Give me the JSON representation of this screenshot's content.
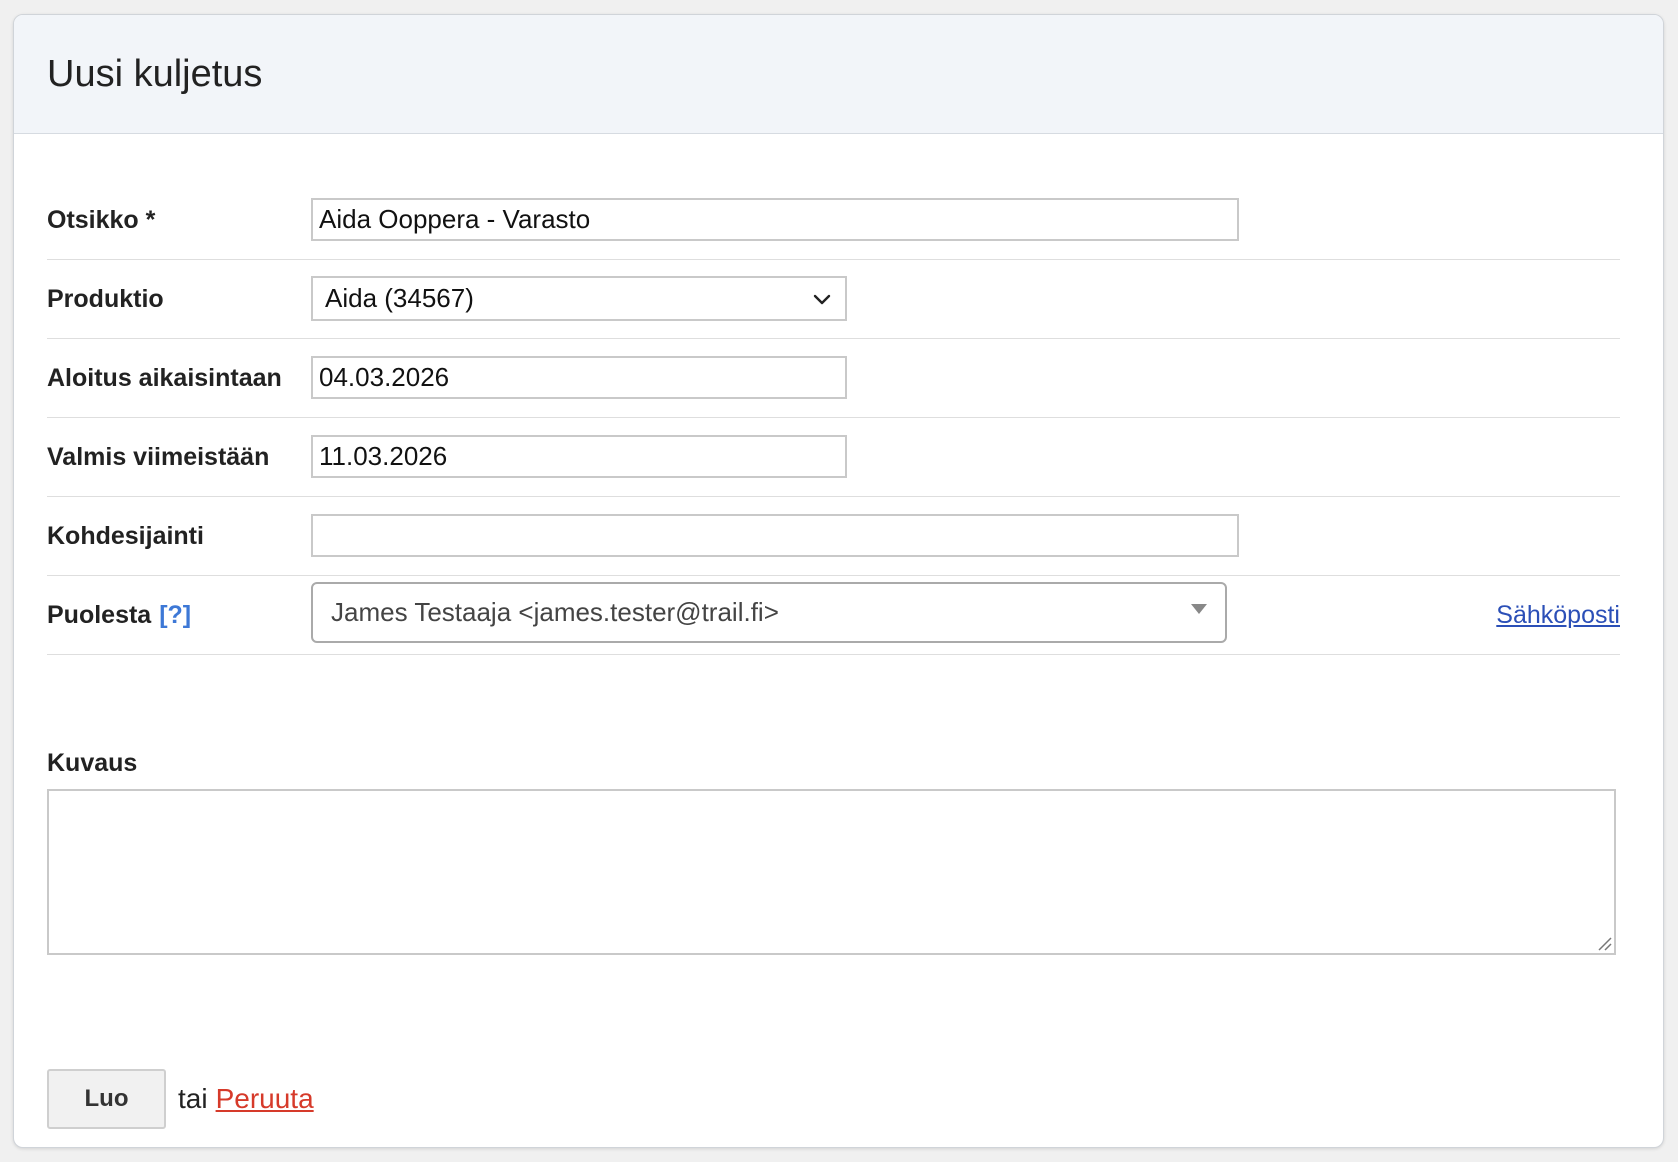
{
  "header": {
    "title": "Uusi kuljetus"
  },
  "form": {
    "title_field": {
      "label": "Otsikko *",
      "value": "Aida Ooppera - Varasto"
    },
    "production": {
      "label": "Produktio",
      "selected": "Aida (34567)"
    },
    "start_earliest": {
      "label": "Aloitus aikaisintaan",
      "value": "04.03.2026"
    },
    "ready_by": {
      "label": "Valmis viimeistään",
      "value": "11.03.2026"
    },
    "destination": {
      "label": "Kohdesijainti",
      "value": ""
    },
    "on_behalf": {
      "label": "Puolesta",
      "help": "[?]",
      "selected": "James Testaaja <james.tester@trail.fi>",
      "email_link": "Sähköposti"
    },
    "description": {
      "label": "Kuvaus",
      "value": ""
    }
  },
  "actions": {
    "create_label": "Luo",
    "or_text": "tai",
    "cancel_label": "Peruuta"
  },
  "colors": {
    "header_bg": "#f2f5f9",
    "help_link": "#3d78d6",
    "email_link": "#2b4fb7",
    "cancel_link": "#d63a2a"
  }
}
